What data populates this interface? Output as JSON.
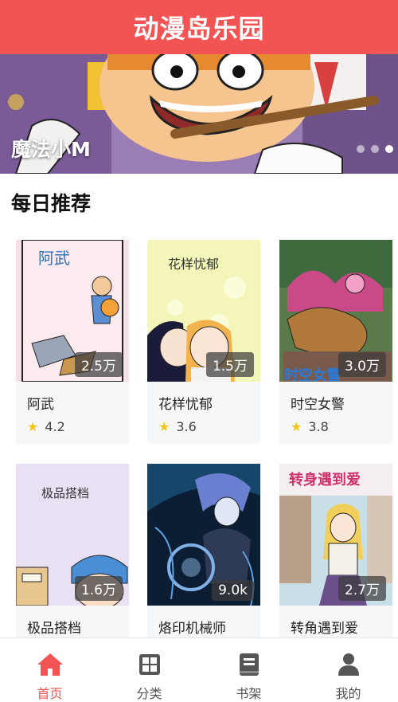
{
  "app": {
    "title": "动漫岛乐园"
  },
  "banner": {
    "title": "魔法小M",
    "dot_count": 3,
    "active_dot": 3
  },
  "section": {
    "title": "每日推荐"
  },
  "comics": [
    {
      "name": "阿武",
      "views": "2.5万",
      "rating": "4.2",
      "cover_text": "阿武"
    },
    {
      "name": "花样忧郁",
      "views": "1.5万",
      "rating": "3.6",
      "cover_text": "花样忧郁"
    },
    {
      "name": "时空女警",
      "views": "3.0万",
      "rating": "3.8",
      "cover_text": "时空女警"
    },
    {
      "name": "极品搭档",
      "views": "1.6万",
      "rating": "",
      "cover_text": "极品搭档"
    },
    {
      "name": "烙印机械师",
      "views": "9.0k",
      "rating": "",
      "cover_text": ""
    },
    {
      "name": "转角遇到爱",
      "views": "2.7万",
      "rating": "",
      "cover_text": "转身遇到爱"
    }
  ],
  "tabbar": {
    "items": [
      {
        "label": "首页",
        "icon": "home-icon",
        "active": true
      },
      {
        "label": "分类",
        "icon": "category-icon",
        "active": false
      },
      {
        "label": "书架",
        "icon": "bookshelf-icon",
        "active": false
      },
      {
        "label": "我的",
        "icon": "profile-icon",
        "active": false
      }
    ]
  },
  "colors": {
    "primary": "#f25353",
    "star": "#f5c518",
    "inactive": "#555555"
  }
}
